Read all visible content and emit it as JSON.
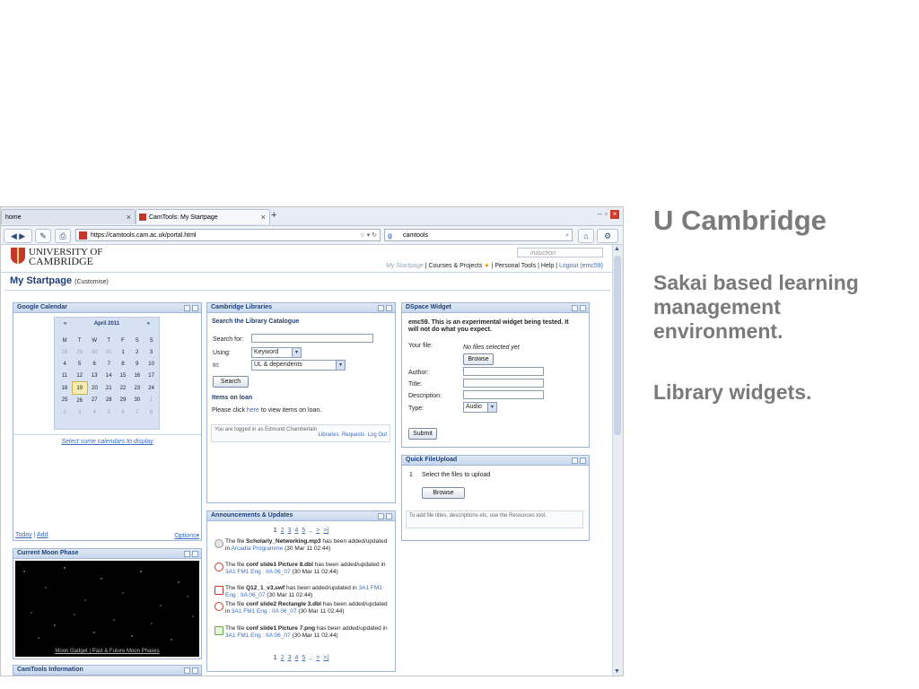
{
  "slide": {
    "title": "U Cambridge",
    "subtitle": "Sakai based learning management environment.",
    "library_note": "Library widgets."
  },
  "browser": {
    "tabs": [
      {
        "label": "home"
      },
      {
        "label": "CamTools: My Startpage"
      }
    ],
    "url": "https://camtools.cam.ac.uk/portal.html",
    "search_text": "camtools"
  },
  "portal": {
    "logo_line1": "UNIVERSITY OF",
    "logo_line2": "CAMBRIDGE",
    "site_search_placeholder": "induction",
    "links": {
      "my_startpage": "My Startpage",
      "courses": "Courses & Projects",
      "personal": "Personal Tools",
      "help": "Help",
      "logout": "Logout (emc59)"
    },
    "page_title": "My Startpage",
    "customise": "(Customise)"
  },
  "google_calendar": {
    "title": "Google Calendar",
    "month": "April 2011",
    "weekdays": [
      "M",
      "T",
      "W",
      "T",
      "F",
      "S",
      "S"
    ],
    "weeks": [
      [
        "28",
        "29",
        "30",
        "31",
        "1",
        "2",
        "3"
      ],
      [
        "4",
        "5",
        "6",
        "7",
        "8",
        "9",
        "10"
      ],
      [
        "11",
        "12",
        "13",
        "14",
        "15",
        "16",
        "17"
      ],
      [
        "18",
        "19",
        "20",
        "21",
        "22",
        "23",
        "24"
      ],
      [
        "25",
        "26",
        "27",
        "28",
        "29",
        "30",
        "1"
      ],
      [
        "2",
        "3",
        "4",
        "5",
        "6",
        "7",
        "8"
      ]
    ],
    "select_link": "Select some calendars to display",
    "today": "Today",
    "add": "Add",
    "options": "Options"
  },
  "moon": {
    "title": "Current Moon Phase",
    "links": "Moon Gadget | Past & Future Moon Phases"
  },
  "camtools_info": {
    "title": "CamTools Information"
  },
  "libraries": {
    "title": "Cambridge Libraries",
    "search_heading": "Search the Library Catalogue",
    "search_for_label": "Search for:",
    "using_label": "Using:",
    "using_value": "Keyword",
    "in_label": "In:",
    "in_value": "UL & dependents",
    "search_button": "Search",
    "items_heading": "Items on loan",
    "items_text_pre": "Please click",
    "items_link": "here",
    "items_text_post": "to view items on loan.",
    "logged_in": "You are logged in as Edmund Chamberlain",
    "note_links": "Libraries  Requests  Log Out"
  },
  "announcements": {
    "title": "Announcements & Updates",
    "pages": [
      "1",
      "2",
      "3",
      "4",
      "5",
      "..",
      ">",
      ">|"
    ],
    "items": [
      {
        "pre": "The file ",
        "file": "Scholarly_Networking.mp3",
        "mid": " has been added/updated in ",
        "site": "Arcadia Programme",
        "post": " (30 Mar 11 02:44)",
        "icon_color": "#b8b8b8"
      },
      {
        "pre": "The file ",
        "file": "conf slide1 Picture 8.dbl",
        "mid": " has been added/updated in ",
        "site": "3A1 FM1 Eng : IIA 06_07",
        "post": " (30 Mar 11 02:44)",
        "icon_color": "#d23b2a"
      },
      {
        "pre": "The file ",
        "file": "Q12_1_v3.swf",
        "mid": " has been added/updated in ",
        "site": "3A1 FM1 Eng : IIA 06_07",
        "post": " (30 Mar 11 02:44)",
        "icon_color": "#c0392b"
      },
      {
        "pre": "The file ",
        "file": "conf slide2 Rectangle 3.dbl",
        "mid": " has been added/updated in ",
        "site": "3A1 FM1 Eng : IIA 06_07",
        "post": " (30 Mar 11 02:44)",
        "icon_color": "#d23b2a"
      },
      {
        "pre": "The file ",
        "file": "conf slide1 Picture 7.png",
        "mid": " has been added/updated in ",
        "site": "3A1 FM1 Eng : IIA 06_07",
        "post": " (30 Mar 11 02:44)",
        "icon_color": "#6aa84f"
      }
    ]
  },
  "dspace": {
    "title": "DSpace Widget",
    "warning": "emc59. This is an experimental widget being tested. It will not do what you expect.",
    "your_file_label": "Your file:",
    "no_files": "No files selected yet",
    "browse_button": "Browse",
    "author_label": "Author:",
    "title_label": "Title:",
    "description_label": "Description:",
    "type_label": "Type:",
    "type_value": "Audio",
    "submit_button": "Submit"
  },
  "quick_upload": {
    "title": "Quick FileUpload",
    "step": "1",
    "step_text": "Select the files to upload",
    "browse_button": "Browse",
    "hint": "To add file titles, descriptions etc, use the Resources tool."
  }
}
